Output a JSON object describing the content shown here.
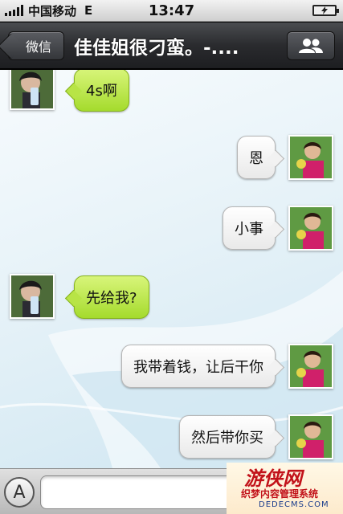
{
  "status_bar": {
    "carrier": "中国移动",
    "network": "E",
    "time": "13:47"
  },
  "nav": {
    "back_label": "微信",
    "title": "佳佳姐很刁蛮。-....",
    "contacts_icon": "contacts-icon"
  },
  "messages": [
    {
      "side": "left",
      "text": "4s啊"
    },
    {
      "side": "right",
      "text": "恩"
    },
    {
      "side": "right",
      "text": "小事"
    },
    {
      "side": "left",
      "text": "先给我?"
    },
    {
      "side": "right",
      "text": "我带着钱，让后干你"
    },
    {
      "side": "right",
      "text": "然后带你买"
    }
  ],
  "input_bar": {
    "toggle_label": "A",
    "message_value": ""
  },
  "watermark": {
    "logo": "游侠网",
    "subtitle": "织梦内容管理系统",
    "url": "DEDECMS.COM"
  },
  "colors": {
    "incoming_bubble": "#b8e446",
    "outgoing_bubble": "#f2f2f2",
    "nav_bar": "#2a2b2e"
  }
}
